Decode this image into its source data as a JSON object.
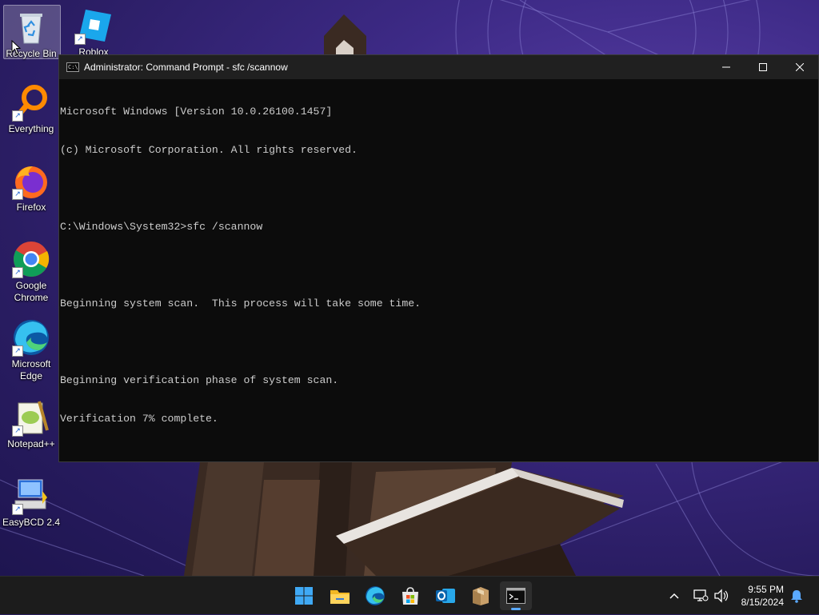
{
  "desktop": {
    "icons": [
      {
        "label": "Recycle Bin"
      },
      {
        "label": "Roblox Studio"
      },
      {
        "label": "Everything"
      },
      {
        "label": "Firefox"
      },
      {
        "label": "Google Chrome"
      },
      {
        "label": "Microsoft Edge"
      },
      {
        "label": "Notepad++"
      },
      {
        "label": "EasyBCD 2.4"
      }
    ]
  },
  "window": {
    "title": "Administrator: Command Prompt - sfc  /scannow",
    "icon": "cmd-icon",
    "controls": {
      "minimize": "—",
      "maximize": "☐",
      "close": "✕"
    },
    "console_lines": [
      "Microsoft Windows [Version 10.0.26100.1457]",
      "(c) Microsoft Corporation. All rights reserved.",
      "",
      "C:\\Windows\\System32>sfc /scannow",
      "",
      "Beginning system scan.  This process will take some time.",
      "",
      "Beginning verification phase of system scan.",
      "Verification 7% complete."
    ]
  },
  "taskbar": {
    "items": [
      {
        "name": "start-button",
        "icon": "windows-logo-icon"
      },
      {
        "name": "file-explorer",
        "icon": "folder-icon"
      },
      {
        "name": "edge",
        "icon": "edge-icon"
      },
      {
        "name": "microsoft-store",
        "icon": "store-icon"
      },
      {
        "name": "outlook",
        "icon": "outlook-icon"
      },
      {
        "name": "package-app",
        "icon": "box-icon"
      },
      {
        "name": "command-prompt",
        "icon": "terminal-icon",
        "active": true
      }
    ],
    "tray": {
      "chevron": "^",
      "time": "9:55 PM",
      "date": "8/15/2024"
    }
  },
  "colors": {
    "console_bg": "#0c0c0c",
    "console_fg": "#cccccc",
    "titlebar_bg": "#202020",
    "taskbar_bg": "#1c1c1c",
    "accent": "#5aa9ff"
  }
}
